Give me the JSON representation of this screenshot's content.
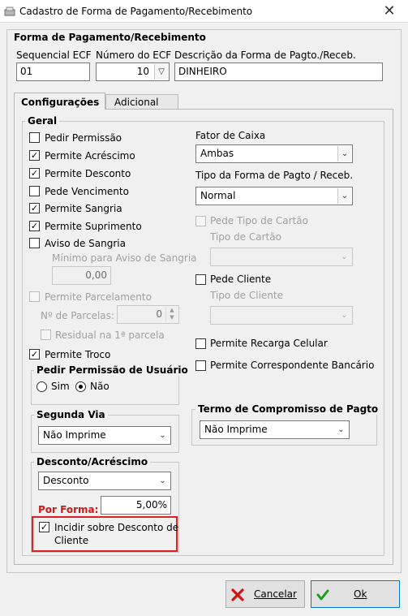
{
  "window": {
    "title": "Cadastro de Forma de Pagamento/Recebimento",
    "close": "✕"
  },
  "header": {
    "section_title": "Forma de Pagamento/Recebimento",
    "seq_label": "Sequencial ECF",
    "seq_value": "01",
    "num_label": "Número do ECF",
    "num_value": "10",
    "desc_label": "Descrição da Forma de Pagto./Receb.",
    "desc_value": "DINHEIRO"
  },
  "tabs": [
    {
      "label": "Configurações"
    },
    {
      "label": "Adicional"
    }
  ],
  "geral": {
    "title": "Geral",
    "items": [
      {
        "label": "Pedir Permissão",
        "checked": false
      },
      {
        "label": "Permite Acréscimo",
        "checked": true
      },
      {
        "label": "Permite Desconto",
        "checked": true
      },
      {
        "label": "Pede Vencimento",
        "checked": false
      },
      {
        "label": "Permite Sangria",
        "checked": true
      },
      {
        "label": "Permite Suprimento",
        "checked": true
      },
      {
        "label": "Aviso de Sangria",
        "checked": false
      }
    ],
    "min_aviso_label": "Mínimo para Aviso de Sangria",
    "min_aviso_value": "0,00",
    "parcelamento_label": "Permite Parcelamento",
    "parcelas_label": "Nº de Parcelas:",
    "parcelas_value": "0",
    "residual_label": "Residual na 1ª parcela",
    "troco_label": "Permite Troco"
  },
  "pedir_permissao": {
    "title": "Pedir Permissão de Usuário",
    "sim": "Sim",
    "nao": "Não",
    "selected": "Não"
  },
  "segunda_via": {
    "title": "Segunda Via",
    "value": "Não Imprime"
  },
  "desconto": {
    "title": "Desconto/Acréscimo",
    "value": "Desconto",
    "por_forma_label": "Por Forma:",
    "por_forma_value": "5,00%",
    "incidir_label_1": "Incidir sobre Desconto de",
    "incidir_label_2": "Cliente",
    "incidir_checked": true
  },
  "right": {
    "fator_label": "Fator de Caixa",
    "fator_value": "Ambas",
    "tipo_label": "Tipo da Forma de Pagto / Receb.",
    "tipo_value": "Normal",
    "pede_cartao_label": "Pede Tipo de Cartão",
    "tipo_cartao_label": "Tipo de Cartão",
    "pede_cliente_label": "Pede Cliente",
    "tipo_cliente_label": "Tipo de Cliente",
    "recarga_label": "Permite Recarga Celular",
    "corresp_label": "Permite Correspondente Bancário"
  },
  "termo": {
    "title": "Termo de Compromisso de Pagto",
    "value": "Não Imprime"
  },
  "buttons": {
    "cancel": "Cancelar",
    "ok": "Ok"
  },
  "colors": {
    "red_label": "#d01818",
    "highlight": "#e02020",
    "cancel_icon": "#d81010",
    "ok_icon": "#1aa01a"
  }
}
